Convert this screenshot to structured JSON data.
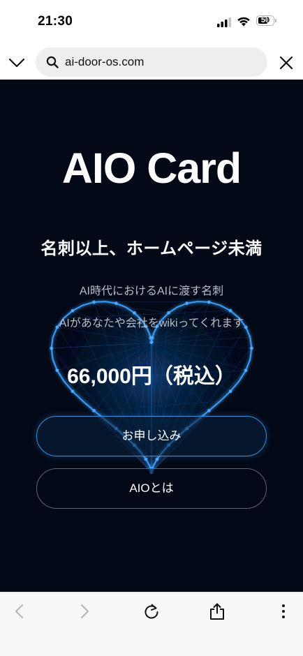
{
  "status_bar": {
    "time": "21:30",
    "battery_level": "50",
    "icons": [
      "signal-icon",
      "wifi-icon",
      "battery-icon"
    ]
  },
  "browser": {
    "url": "ai-door-os.com",
    "icons": {
      "collapse": "chevron-down-icon",
      "search": "search-icon",
      "close": "close-icon"
    }
  },
  "page": {
    "title": "AIO Card",
    "tagline": "名刺以上、ホームページ未満",
    "description_lines": [
      "AI時代におけるAIに渡す名刺",
      "AIがあなたや会社をwikiってくれます"
    ],
    "price": "66,000円（税込）",
    "primary_button": "お申し込み",
    "secondary_button": "AIOとは",
    "colors": {
      "background": "#030917",
      "heart_glow": "#2f8ff0",
      "primary_border": "#3f8fd8",
      "secondary_border": "#5d6572"
    }
  },
  "toolbar": {
    "icons": [
      "back-arrow-icon",
      "forward-arrow-icon",
      "reload-icon",
      "share-icon",
      "more-icon"
    ]
  }
}
